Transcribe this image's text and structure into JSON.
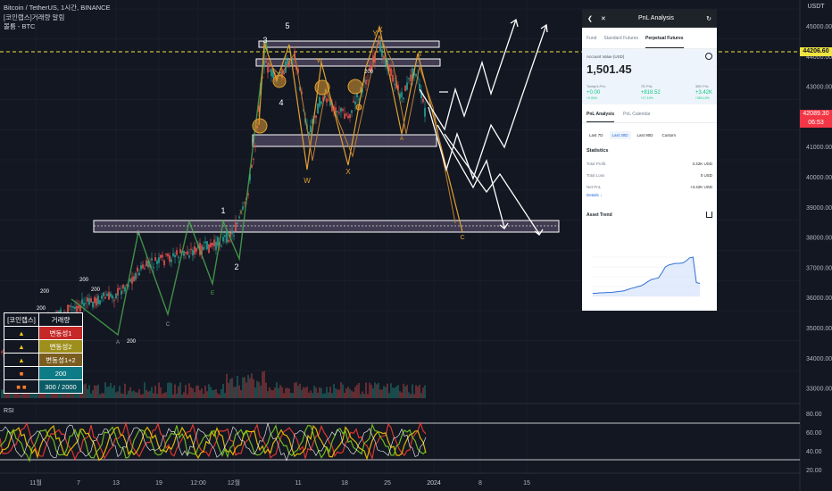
{
  "legend": {
    "symbol_line": "Bitcoin / TetherUS, 1시간, BINANCE",
    "indicator_line": "[코인랩스]거래량 알림",
    "bb_line": "볼룸 - BTC"
  },
  "price_axis": {
    "currency": "USDT",
    "labels": [
      "45000.00",
      "44000.00",
      "43000.00",
      "42000.00",
      "41000.00",
      "40000.00",
      "39000.00",
      "38000.00",
      "37000.00",
      "36000.00",
      "35000.00",
      "34000.00",
      "33000.00"
    ],
    "current_price": "44206.60",
    "last_price": "42089.30",
    "countdown": "06:53",
    "current_price_color": "#f0e442",
    "last_price_color": "#f23645"
  },
  "rsi_axis": {
    "title": "RSI",
    "labels": [
      "80.00",
      "60.00",
      "40.00",
      "20.00"
    ]
  },
  "time_axis": {
    "labels": [
      "11월",
      "7",
      "13",
      "19",
      "12:00",
      "12월",
      "11",
      "18",
      "25",
      "2024",
      "8",
      "15"
    ]
  },
  "annotations": {
    "wave_labels": [
      "1",
      "2",
      "3",
      "4",
      "5",
      "W",
      "X",
      "Y",
      "W",
      "X",
      "Y",
      "A",
      "B",
      "C",
      "A",
      "B",
      "C",
      "E",
      "X"
    ],
    "level_labels": [
      "200",
      "200",
      "200",
      "200",
      "200",
      "200"
    ]
  },
  "legend_table": {
    "header": [
      "[코인랩스]",
      "거래량"
    ],
    "rows": [
      {
        "icon": "yellow-triangle-icon",
        "label": "변동성1",
        "color": "#c62828"
      },
      {
        "icon": "yellow-triangle-icon",
        "label": "변동성2",
        "color": "#9e8f1c"
      },
      {
        "icon": "yellow-triangle-icon",
        "label": "변동성1+2",
        "color": "#7a5d1f"
      },
      {
        "icon": "orange-square-icon",
        "label": "200",
        "color": "#0e7c86"
      },
      {
        "icon": "orange-squares-icon",
        "label": "300 / 2000",
        "color": "#0a5c66"
      }
    ]
  },
  "pnl_panel": {
    "header": {
      "back_icon": "chevron-left-icon",
      "close_icon": "close-icon",
      "title": "PnL Analysis",
      "refresh_icon": "refresh-icon"
    },
    "tabs": [
      "Fund",
      "Standard Futures",
      "Perpetual Futures"
    ],
    "active_tab": "Perpetual Futures",
    "account_label": "Account Value (USD)",
    "account_value": "1,501.45",
    "pnl": [
      {
        "label": "Today's PnL",
        "value": "+0.00",
        "sub": "+0.00%"
      },
      {
        "label": "7D PnL",
        "value": "+818.52",
        "sub": "+17.19%"
      },
      {
        "label": "30D PnL",
        "value": "+3.42K",
        "sub": "+359.13%"
      }
    ],
    "tabs2": [
      "PnL Analysis",
      "PnL Calendar"
    ],
    "periods": [
      "Last 7D",
      "Last 30D",
      "Last 90D",
      "Custom"
    ],
    "selected_period": "Last 30D",
    "statistics_title": "Statistics",
    "stats": [
      {
        "label": "Total Profit",
        "value": "3.42K USD"
      },
      {
        "label": "Total Loss",
        "value": "0 USD"
      },
      {
        "label": "Net PnL",
        "value": "+3.42K USD"
      }
    ],
    "details": "Details ↓",
    "asset_trend_title": "Asset Trend",
    "trend_values": [
      0.08,
      0.08,
      0.09,
      0.09,
      0.1,
      0.1,
      0.11,
      0.12,
      0.13,
      0.14,
      0.17,
      0.2,
      0.22,
      0.25,
      0.27,
      0.32,
      0.38,
      0.43,
      0.45,
      0.47,
      0.6,
      0.75,
      0.8,
      0.82,
      0.84,
      0.84,
      0.85,
      0.9,
      0.98,
      1.0,
      0.35,
      0.33
    ]
  }
}
